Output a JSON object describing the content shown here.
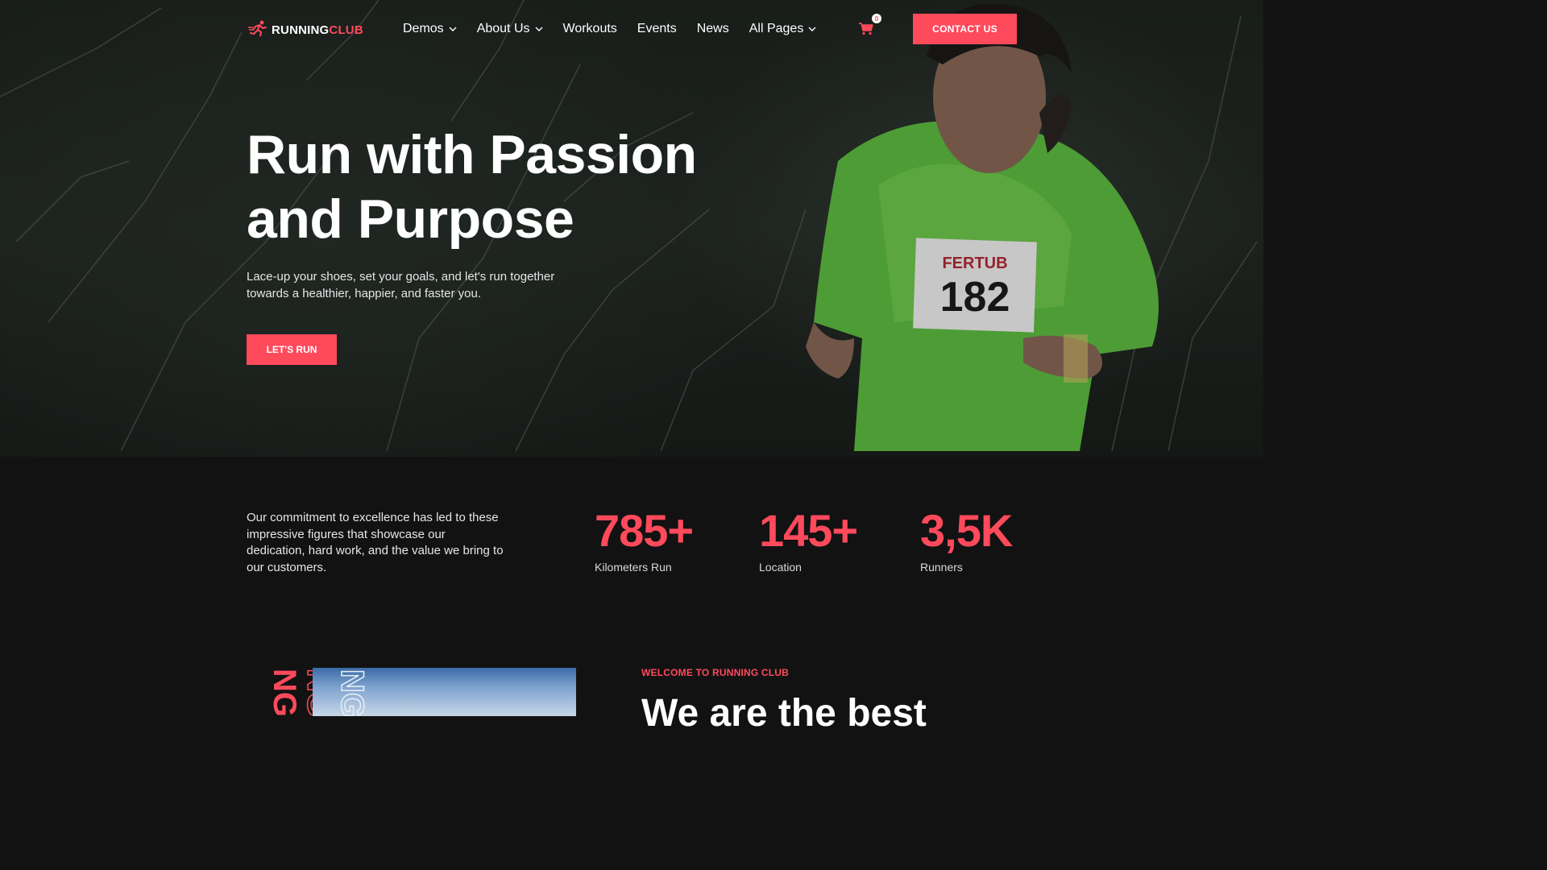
{
  "brand": {
    "logo_icon": "runner-icon",
    "name_part1": "RUNNING",
    "name_part2": "CLUB",
    "accent_color": "#ff4a5c"
  },
  "nav": {
    "items": [
      {
        "label": "Demos",
        "has_dropdown": true
      },
      {
        "label": "About Us",
        "has_dropdown": true
      },
      {
        "label": "Workouts",
        "has_dropdown": false
      },
      {
        "label": "Events",
        "has_dropdown": false
      },
      {
        "label": "News",
        "has_dropdown": false
      },
      {
        "label": "All Pages",
        "has_dropdown": true
      }
    ],
    "cart_icon": "cart-icon",
    "cart_count": "0",
    "contact_label": "CONTACT US"
  },
  "hero": {
    "title": "Run with Passion and Purpose",
    "subtitle": "Lace-up your shoes, set your goals, and let's run together towards a healthier, happier, and faster you.",
    "cta_label": "LET'S RUN"
  },
  "stats": {
    "text": "Our commitment to excellence has led to these impressive figures that showcase our dedication, hard work, and the value we bring to our customers.",
    "items": [
      {
        "value": "785+",
        "label": "Kilometers Run"
      },
      {
        "value": "145+",
        "label": "Location"
      },
      {
        "value": "3,5K",
        "label": "Runners"
      }
    ]
  },
  "welcome": {
    "tag": "WELCOME TO RUNNING CLUB",
    "heading": "We are the best"
  }
}
